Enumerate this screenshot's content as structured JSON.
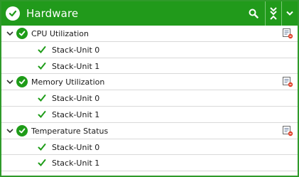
{
  "header": {
    "title": "Hardware",
    "icons": [
      "check-circle-icon",
      "search-icon",
      "collapse-all-icon",
      "chevron-down-icon"
    ],
    "accent": "#219a1b"
  },
  "groups": [
    {
      "label": "CPU Utilization",
      "children": [
        "Stack-Unit 0",
        "Stack-Unit 1"
      ]
    },
    {
      "label": "Memory Utilization",
      "children": [
        "Stack-Unit 0",
        "Stack-Unit 1"
      ]
    },
    {
      "label": "Temperature Status",
      "children": [
        "Stack-Unit 0",
        "Stack-Unit 1"
      ]
    }
  ],
  "status_color": "#1e9c18"
}
